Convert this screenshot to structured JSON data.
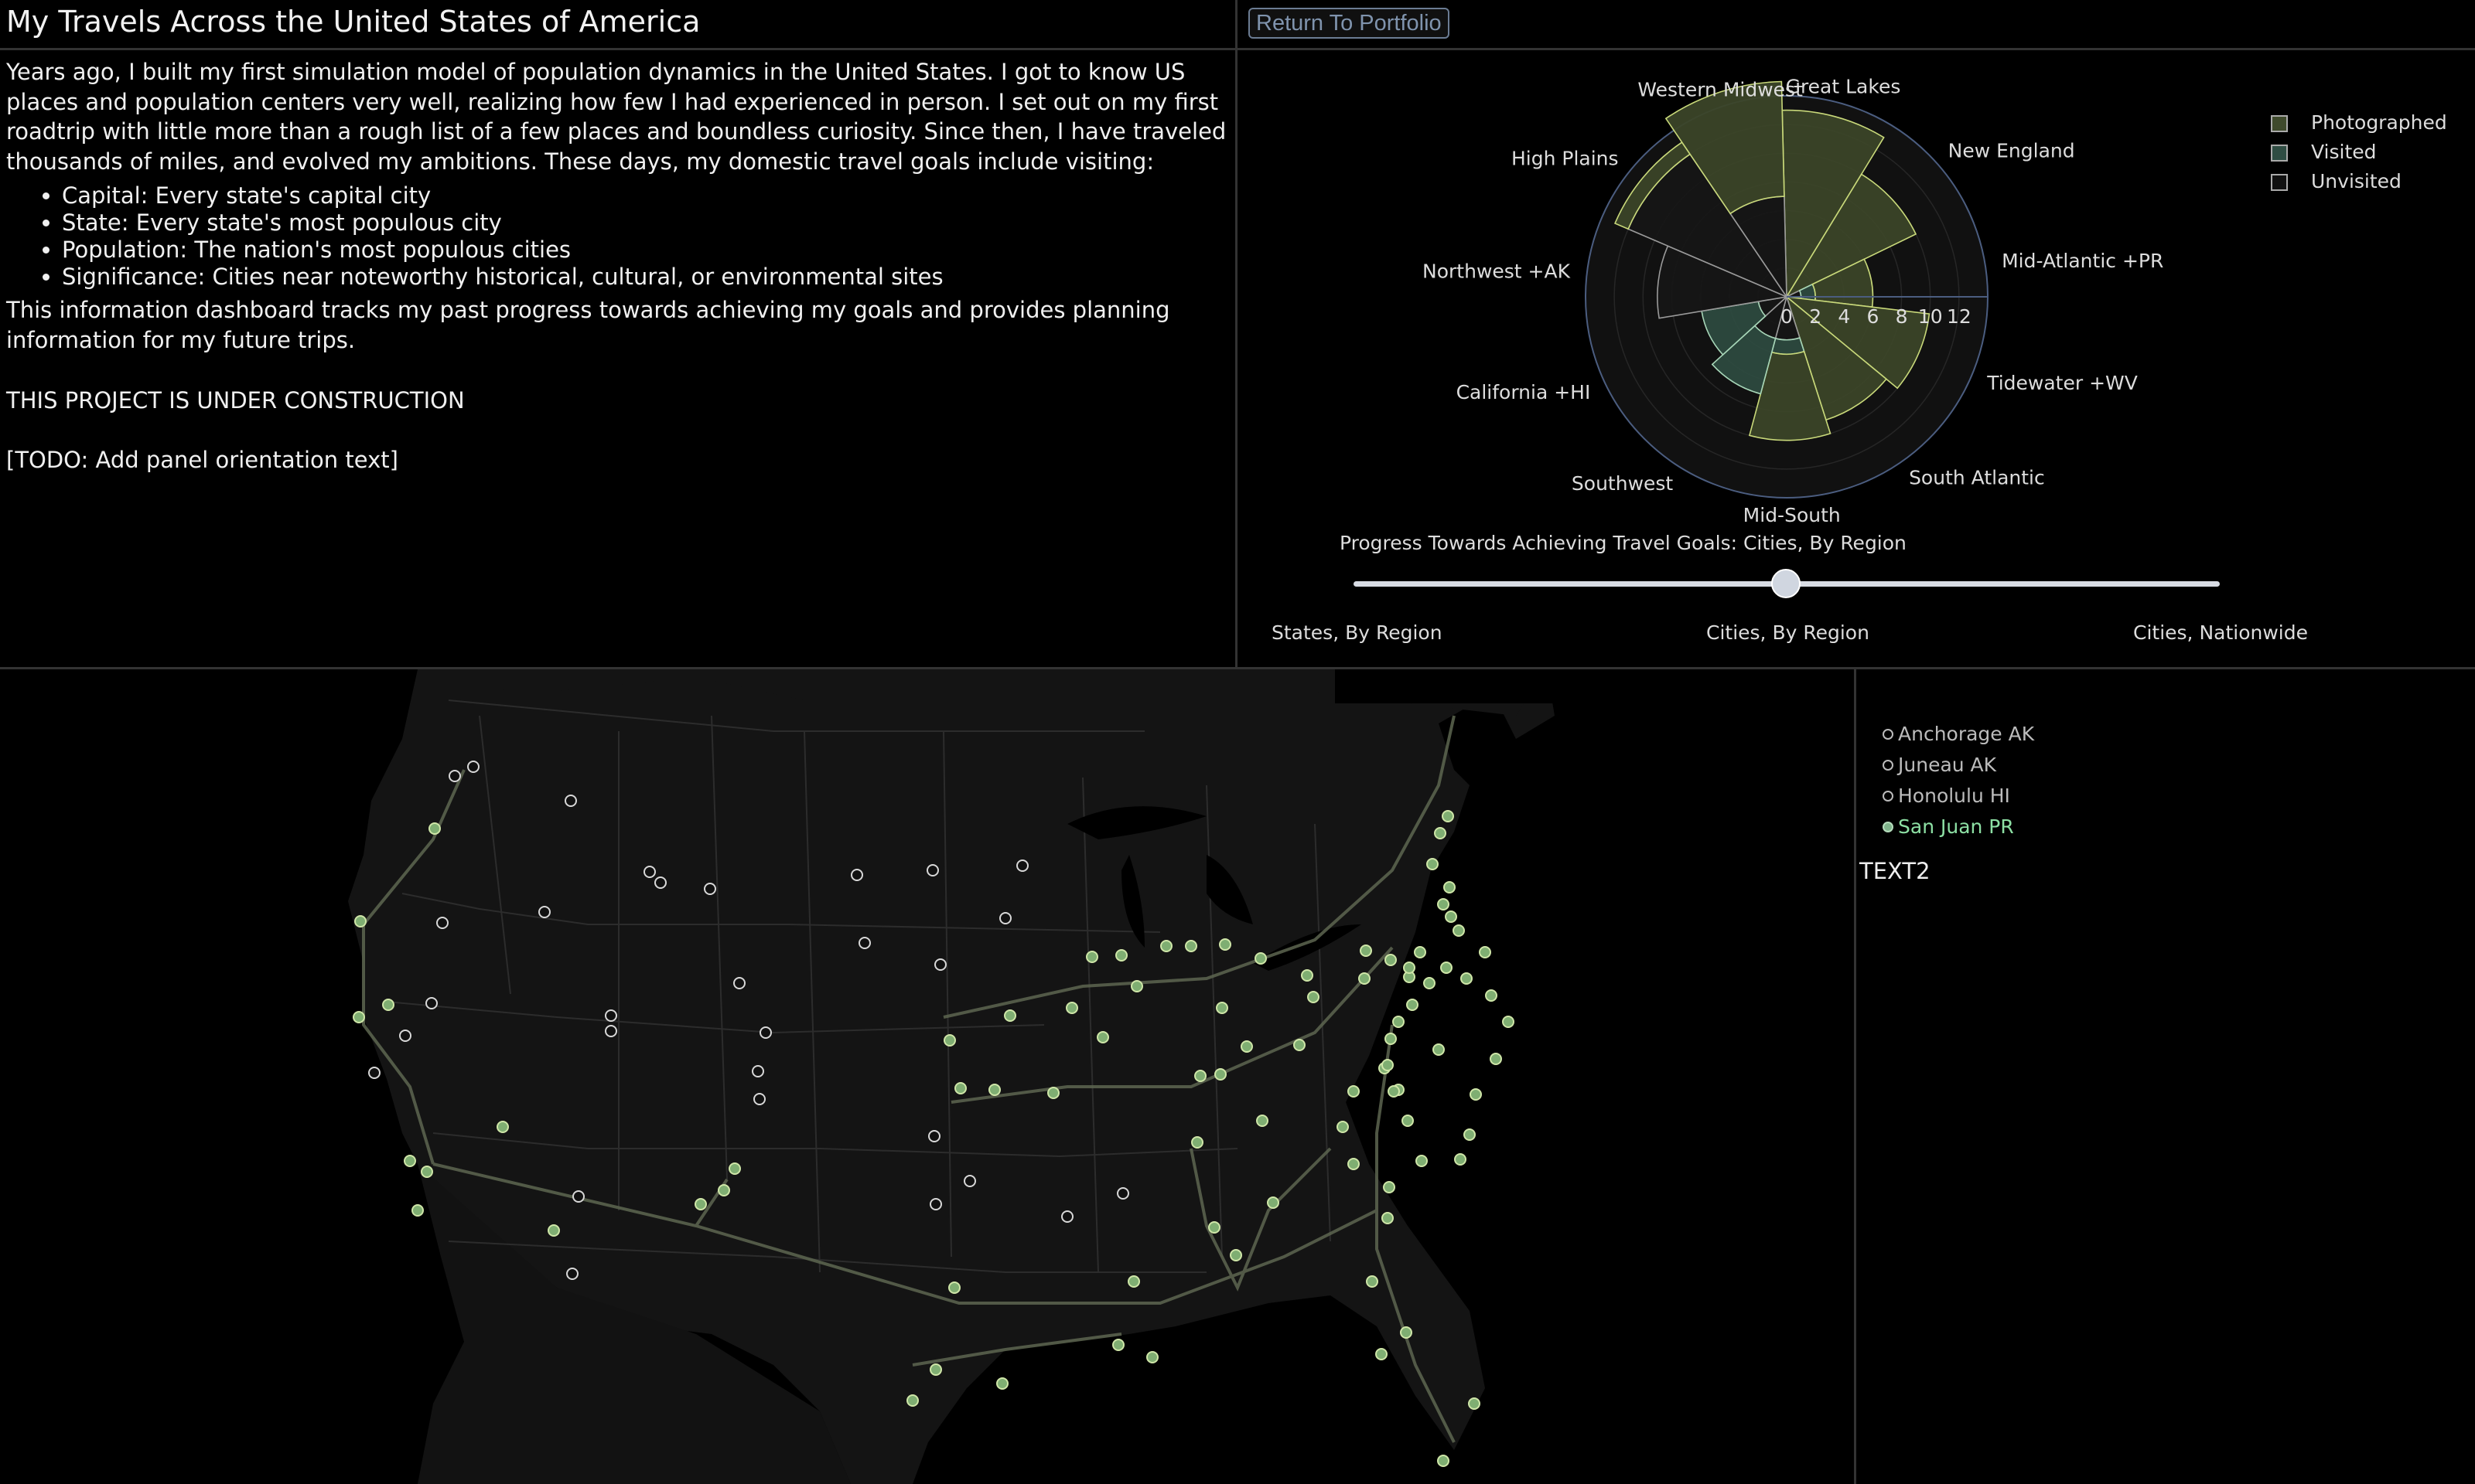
{
  "header": {
    "title": "My Travels Across the United States of America"
  },
  "intro": {
    "paragraph1": "Years ago, I built my first simulation model of population dynamics in the United States. I got to know US places and population centers very well, realizing how few I had experienced in person. I set out on my first roadtrip with little more than a rough list of a few places and boundless curiosity. Since then, I have traveled thousands of miles, and evolved my ambitions. These days, my domestic travel goals include visiting:",
    "goals": [
      "Capital: Every state's capital city",
      "State: Every state's most populous city",
      "Population: The nation's most populous cities",
      "Significance: Cities near noteworthy historical, cultural, or environmental sites"
    ],
    "paragraph2": "This information dashboard tracks my past progress towards achieving my goals and provides planning information for my future trips.",
    "construction": "THIS PROJECT IS UNDER CONSTRUCTION",
    "todo": "[TODO: Add panel orientation text]"
  },
  "toolbar": {
    "return_label": "Return To Portfolio"
  },
  "chart_data": {
    "type": "barpolar",
    "categories": [
      "Great Lakes",
      "New England",
      "Mid-Atlantic +PR",
      "Tidewater +WV",
      "South Atlantic",
      "Mid-South",
      "Southwest",
      "California +HI",
      "Northwest +AK",
      "High Plains",
      "Western Midwest"
    ],
    "series": [
      {
        "name": "Unvisited",
        "values": [
          0,
          0,
          1,
          0,
          0,
          3,
          3,
          2,
          9,
          12,
          7
        ]
      },
      {
        "name": "Visited",
        "values": [
          0,
          0,
          1,
          0,
          0,
          1,
          4,
          4,
          0,
          0,
          0
        ]
      },
      {
        "name": "Photographed",
        "values": [
          13,
          10,
          4,
          10,
          9,
          6,
          0,
          0,
          0,
          1,
          8
        ]
      }
    ],
    "radial_ticks": [
      "0",
      "2",
      "4",
      "6",
      "8",
      "10",
      "12"
    ],
    "rlim": [
      0,
      14
    ],
    "legend_position": "top-right",
    "colors": {
      "Photographed": "#3b4428",
      "Visited": "#2d4a3f",
      "Unvisited": "#161616"
    }
  },
  "legend": {
    "items": [
      {
        "label": "Photographed",
        "color": "#3f4a2c"
      },
      {
        "label": "Visited",
        "color": "#2f4d43"
      },
      {
        "label": "Unvisited",
        "color": "#111111"
      }
    ]
  },
  "slider": {
    "title": "Progress Towards Achieving Travel Goals: Cities, By Region",
    "steps": [
      "States, By Region",
      "Cities, By Region",
      "Cities, Nationwide"
    ],
    "active_step": 1
  },
  "map": {
    "visited_color": "#7fae72",
    "unvisited_color": "#111111"
  },
  "sidebar": {
    "cities": [
      {
        "label": "Anchorage AK",
        "visited": false
      },
      {
        "label": "Juneau AK",
        "visited": false
      },
      {
        "label": "Honolulu HI",
        "visited": false
      },
      {
        "label": "San Juan PR",
        "visited": true
      }
    ],
    "text2": "TEXT2"
  }
}
